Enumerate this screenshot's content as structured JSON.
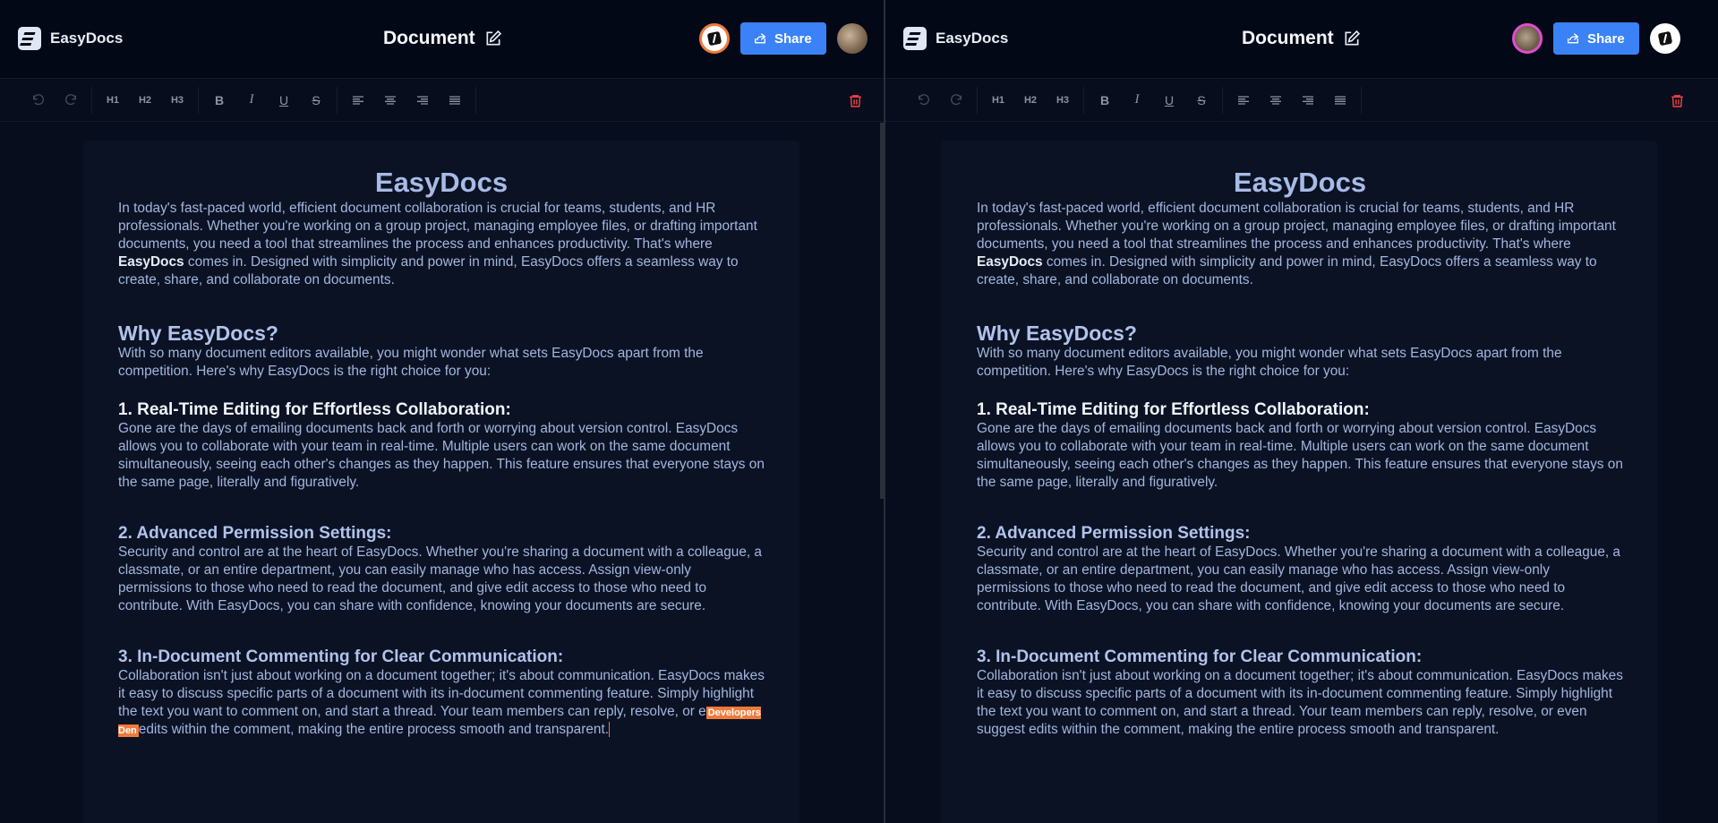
{
  "brand": {
    "name": "EasyDocs"
  },
  "document": {
    "title": "Document",
    "heading": "EasyDocs",
    "intro_before": "In today's fast-paced world, efficient document collaboration is crucial for teams, students, and HR professionals. Whether you're working on a group project, managing employee files, or drafting important documents, you need a tool that streamlines the process and enhances productivity. That's where ",
    "intro_bold": "EasyDocs",
    "intro_after": " comes in. Designed with simplicity and power in mind, EasyDocs offers a seamless way to create, share, and collaborate on documents.",
    "why_heading": "Why EasyDocs?",
    "why_text": "With so many document editors available, you might wonder what sets EasyDocs apart from the competition. Here's why EasyDocs is the right choice for you:",
    "s1_heading": "1. Real-Time Editing for Effortless Collaboration:",
    "s1_text": "Gone are the days of emailing documents back and forth or worrying about version control. EasyDocs allows you to collaborate with your team in real-time. Multiple users can work on the same document simultaneously, seeing each other's changes as they happen. This feature ensures that everyone stays on the same page, literally and figuratively.",
    "s2_heading": "2. Advanced Permission Settings:",
    "s2_text": "Security and control are at the heart of EasyDocs. Whether you're sharing a document with a colleague, a classmate, or an entire department, you can easily manage who has access. Assign view-only permissions to those who need to read the document, and give edit access to those who need to contribute. With EasyDocs, you can share with confidence, knowing your documents are secure.",
    "s3_heading": "3. In-Document Commenting for Clear Communication:",
    "s3_text_a": "Collaboration isn't just about working on a document together; it's about communication. EasyDocs makes it easy to discuss specific parts of a document with its in-document commenting feature. Simply highlight the text you want to comment on, and start a thread. Your team members can reply, resolve, or e",
    "s3_text_b": "edits within the comment, making the entire process smooth and transparent.",
    "s3_text_full": "Collaboration isn't just about working on a document together; it's about communication. EasyDocs makes it easy to discuss specific parts of a document with its in-document commenting feature. Simply highlight the text you want to comment on, and start a thread. Your team members can reply, resolve, or even suggest edits within the comment, making the entire process smooth and transparent."
  },
  "collaborator_cursor": {
    "name": "Developers Den",
    "color": "#f07a3a"
  },
  "share_label": "Share",
  "toolbar": {
    "h1": "H1",
    "h2": "H2",
    "h3": "H3",
    "bold": "B",
    "italic": "I",
    "underline": "U",
    "strike": "S"
  },
  "colors": {
    "accent": "#3b82f6",
    "danger": "#ef4444",
    "background": "#070d1c"
  }
}
